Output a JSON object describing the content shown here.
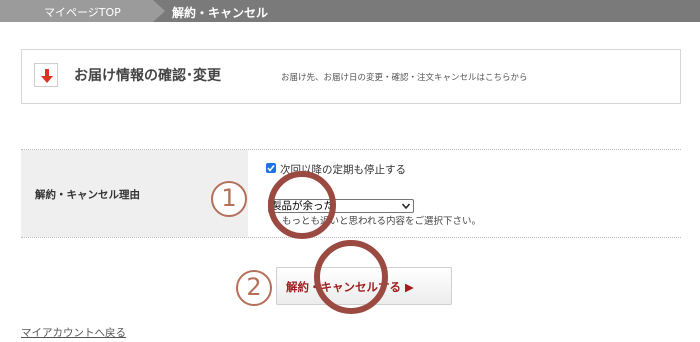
{
  "breadcrumb": {
    "top": "マイページTOP",
    "current": "解約・キャンセル"
  },
  "info": {
    "icon": "red-down-arrow",
    "title": "お届け情報の確認･変更",
    "description": "お届け先、お届け日の変更・確認・注文キャンセルはこちらから"
  },
  "reason": {
    "label": "解約・キャンセル理由",
    "checkbox_checked": true,
    "checkbox_label": "次回以降の定期も停止する",
    "select_value": "製品が余った",
    "note": "もっとも近いと思われる内容をご選択下さい。"
  },
  "markers": {
    "one": "1",
    "two": "2"
  },
  "cancel_button": {
    "label": "解約・キャンセルする ▶"
  },
  "back_link": "マイアカウントへ戻る",
  "colors": {
    "breadcrumb_bar": "#7a7a7a",
    "accent_red": "#a01e1e",
    "ring": "#9b4a42",
    "checkbox": "#1a73e8"
  }
}
